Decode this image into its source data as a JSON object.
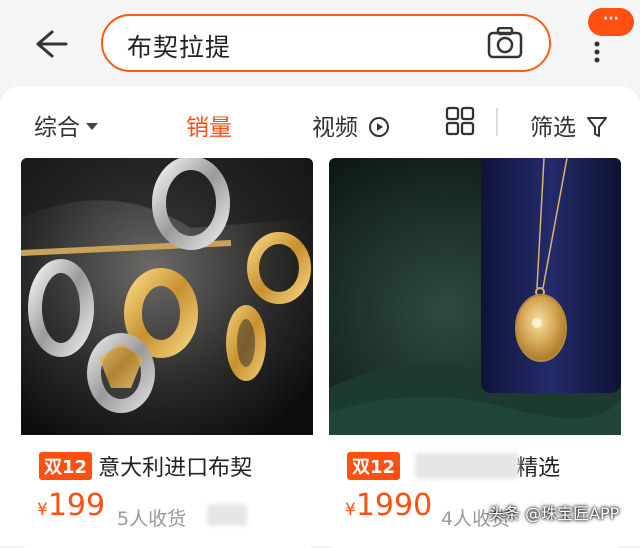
{
  "search": {
    "query": "布契拉提"
  },
  "header": {
    "more_badge": "···"
  },
  "filters": {
    "comprehensive": "综合",
    "sales": "销量",
    "video": "视频",
    "filter": "筛选"
  },
  "products": [
    {
      "tag": "双12",
      "title": "意大利进口布契",
      "currency": "¥",
      "price": "199",
      "sold": "5人收货"
    },
    {
      "tag": "双12",
      "title": "精选",
      "currency": "¥",
      "price": "1990",
      "sold": "4人收货"
    }
  ],
  "watermark": "头条 @珠宝匠APP",
  "colors": {
    "accent": "#ff5011"
  }
}
